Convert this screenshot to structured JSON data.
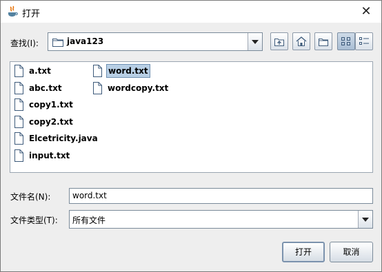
{
  "window": {
    "title": "打开",
    "close_glyph": "✕"
  },
  "lookin": {
    "label": "查找(I):",
    "value": "java123"
  },
  "toolbar": [
    {
      "icon": "up-one-level-icon"
    },
    {
      "icon": "home-icon"
    },
    {
      "icon": "new-folder-icon"
    },
    {
      "icon": "list-view-icon",
      "active": true
    },
    {
      "icon": "details-view-icon"
    }
  ],
  "files": [
    {
      "name": "a.txt"
    },
    {
      "name": "abc.txt"
    },
    {
      "name": "copy1.txt"
    },
    {
      "name": "copy2.txt"
    },
    {
      "name": "Elcetricity.java"
    },
    {
      "name": "input.txt"
    },
    {
      "name": "word.txt",
      "selected": true
    },
    {
      "name": "wordcopy.txt"
    }
  ],
  "filename": {
    "label": "文件名(N):",
    "value": "word.txt"
  },
  "filetype": {
    "label": "文件类型(T):",
    "value": "所有文件"
  },
  "buttons": {
    "open": "打开",
    "cancel": "取消"
  },
  "colors": {
    "selection": "#b8cfe5",
    "dialog_bg": "#eeeeee"
  }
}
